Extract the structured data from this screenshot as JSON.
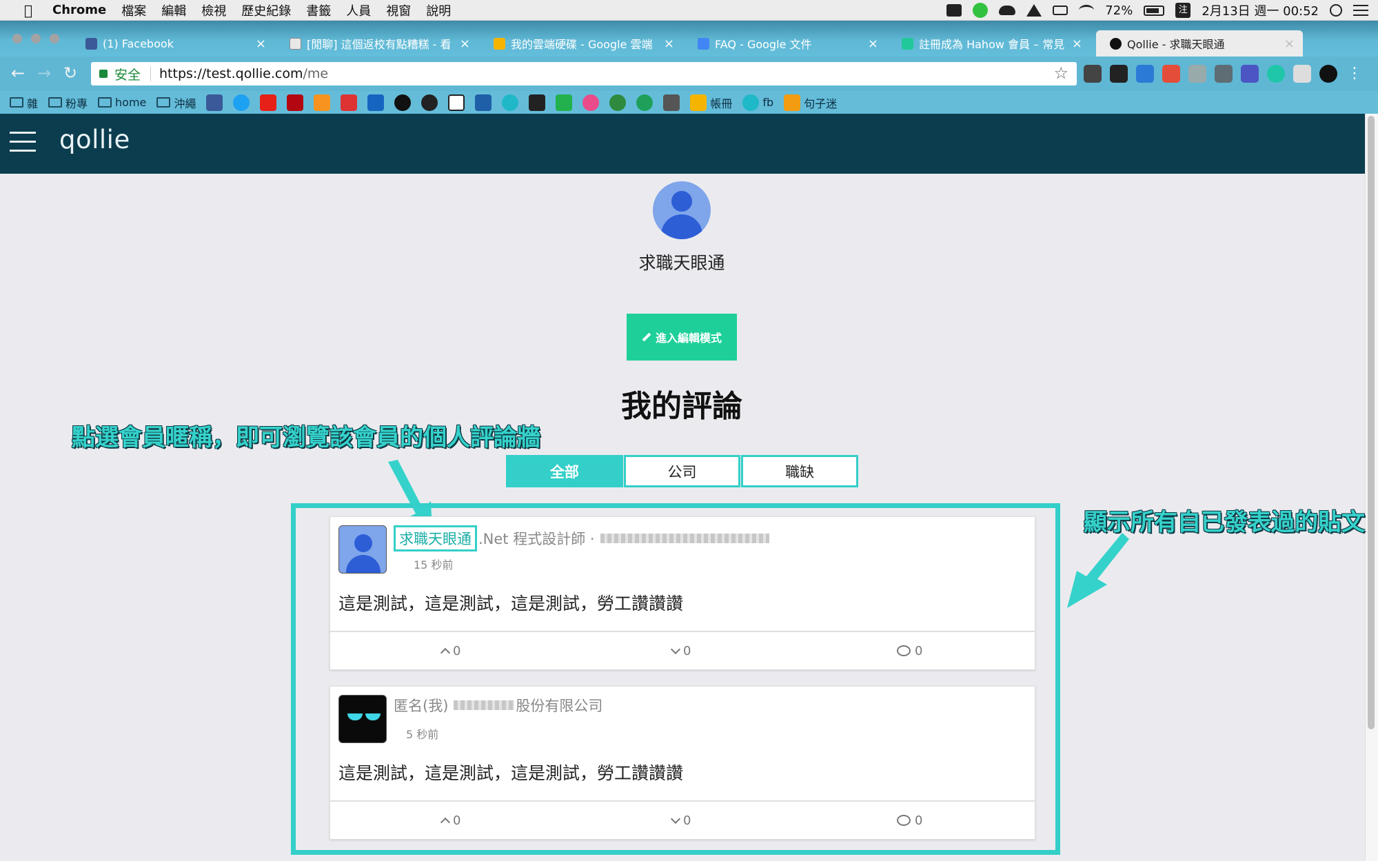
{
  "menubar": {
    "app": "Chrome",
    "items": [
      "檔案",
      "編輯",
      "檢視",
      "歷史紀錄",
      "書籤",
      "人員",
      "視窗",
      "說明"
    ],
    "battery": "72%",
    "ime": "注",
    "datetime": "2月13日 週一 00:52"
  },
  "tabs": [
    {
      "title": "(1) Facebook",
      "color": "#3b5998"
    },
    {
      "title": "[閒聊] 這個返校有點糟糕 - 看",
      "color": "#e8e8e8"
    },
    {
      "title": "我的雲端硬碟 - Google 雲端",
      "color": "#f4b400"
    },
    {
      "title": "FAQ - Google 文件",
      "color": "#4285f4"
    },
    {
      "title": "註冊成為 Hahow 會員 – 常見",
      "color": "#20c997"
    },
    {
      "title": "Qollie - 求職天眼通",
      "color": "#111111"
    }
  ],
  "address": {
    "secure_label": "安全",
    "url_host": "https://test.qollie.com",
    "url_path": "/me"
  },
  "bookmarks": [
    {
      "label": "雜",
      "type": "folder"
    },
    {
      "label": "粉專",
      "type": "folder"
    },
    {
      "label": "home",
      "type": "folder"
    },
    {
      "label": "沖繩",
      "type": "folder"
    },
    {
      "label": "帳冊",
      "type": "drive"
    },
    {
      "label": "fb",
      "type": "c"
    },
    {
      "label": "句子迷",
      "type": "ju"
    }
  ],
  "page": {
    "logo": "qollie",
    "username": "求職天眼通",
    "edit_button": "進入編輯模式",
    "section_title": "我的評論",
    "filter_tabs": [
      "全部",
      "公司",
      "職缺"
    ]
  },
  "annotations": {
    "left": "點選會員暱稱，即可瀏覽該會員的個人評論牆",
    "right": "顯示所有自已發表過的貼文"
  },
  "posts": [
    {
      "author": "求職天眼通",
      "job_title": ".Net 程式設計師 ·",
      "time": "15 秒前",
      "body": "這是測試，這是測試，這是測試，勞工讚讚讚",
      "upvotes": "0",
      "downvotes": "0",
      "comments": "0"
    },
    {
      "author": "匿名(我)",
      "company_suffix": "股份有限公司",
      "time": "5 秒前",
      "body": "這是測試，這是測試，這是測試，勞工讚讚讚",
      "upvotes": "0",
      "downvotes": "0",
      "comments": "0"
    }
  ]
}
